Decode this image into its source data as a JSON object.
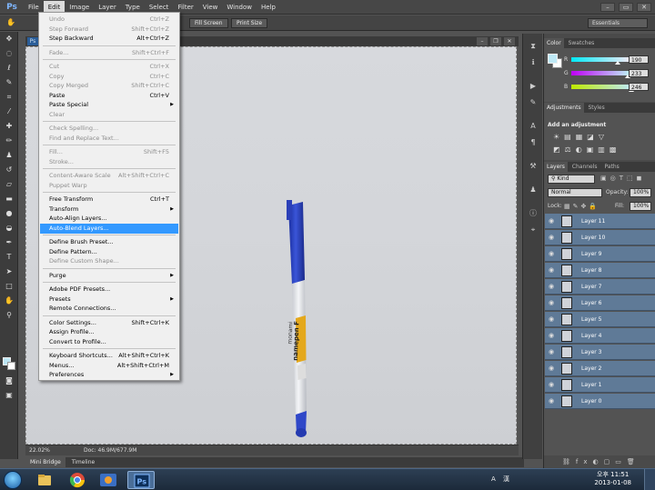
{
  "menubar": {
    "app_logo": "Ps",
    "items": [
      "File",
      "Edit",
      "Image",
      "Layer",
      "Type",
      "Select",
      "Filter",
      "View",
      "Window",
      "Help"
    ]
  },
  "options_bar": {
    "fill_screen": "Fill Screen",
    "print_size": "Print Size",
    "workspace": "Essentials"
  },
  "edit_menu": {
    "items": [
      {
        "label": "Undo",
        "shortcut": "Ctrl+Z",
        "disabled": true
      },
      {
        "label": "Step Forward",
        "shortcut": "Shift+Ctrl+Z",
        "disabled": true
      },
      {
        "label": "Step Backward",
        "shortcut": "Alt+Ctrl+Z",
        "disabled": false
      },
      {
        "label": "Fade...",
        "shortcut": "Shift+Ctrl+F",
        "disabled": true
      },
      {
        "label": "Cut",
        "shortcut": "Ctrl+X",
        "disabled": true
      },
      {
        "label": "Copy",
        "shortcut": "Ctrl+C",
        "disabled": true
      },
      {
        "label": "Copy Merged",
        "shortcut": "Shift+Ctrl+C",
        "disabled": true
      },
      {
        "label": "Paste",
        "shortcut": "Ctrl+V",
        "disabled": false
      },
      {
        "label": "Paste Special",
        "shortcut": "",
        "disabled": false,
        "submenu": true
      },
      {
        "label": "Clear",
        "shortcut": "",
        "disabled": true
      },
      {
        "label": "Check Spelling...",
        "shortcut": "",
        "disabled": true
      },
      {
        "label": "Find and Replace Text...",
        "shortcut": "",
        "disabled": true
      },
      {
        "label": "Fill...",
        "shortcut": "Shift+F5",
        "disabled": true
      },
      {
        "label": "Stroke...",
        "shortcut": "",
        "disabled": true
      },
      {
        "label": "Content-Aware Scale",
        "shortcut": "Alt+Shift+Ctrl+C",
        "disabled": true
      },
      {
        "label": "Puppet Warp",
        "shortcut": "",
        "disabled": true
      },
      {
        "label": "Free Transform",
        "shortcut": "Ctrl+T",
        "disabled": false
      },
      {
        "label": "Transform",
        "shortcut": "",
        "disabled": false,
        "submenu": true
      },
      {
        "label": "Auto-Align Layers...",
        "shortcut": "",
        "disabled": false
      },
      {
        "label": "Auto-Blend Layers...",
        "shortcut": "",
        "disabled": false,
        "highlighted": true
      },
      {
        "label": "Define Brush Preset...",
        "shortcut": "",
        "disabled": false
      },
      {
        "label": "Define Pattern...",
        "shortcut": "",
        "disabled": false
      },
      {
        "label": "Define Custom Shape...",
        "shortcut": "",
        "disabled": true
      },
      {
        "label": "Purge",
        "shortcut": "",
        "disabled": false,
        "submenu": true
      },
      {
        "label": "Adobe PDF Presets...",
        "shortcut": "",
        "disabled": false
      },
      {
        "label": "Presets",
        "shortcut": "",
        "disabled": false,
        "submenu": true
      },
      {
        "label": "Remote Connections...",
        "shortcut": "",
        "disabled": false
      },
      {
        "label": "Color Settings...",
        "shortcut": "Shift+Ctrl+K",
        "disabled": false
      },
      {
        "label": "Assign Profile...",
        "shortcut": "",
        "disabled": false
      },
      {
        "label": "Convert to Profile...",
        "shortcut": "",
        "disabled": false
      },
      {
        "label": "Keyboard Shortcuts...",
        "shortcut": "Alt+Shift+Ctrl+K",
        "disabled": false
      },
      {
        "label": "Menus...",
        "shortcut": "Alt+Shift+Ctrl+M",
        "disabled": false
      },
      {
        "label": "Preferences",
        "shortcut": "",
        "disabled": false,
        "submenu": true
      }
    ]
  },
  "document": {
    "tab_logo": "Ps",
    "marker_brand": "monami",
    "marker_label": "namepen F"
  },
  "status": {
    "zoom": "22.02%",
    "doc_size": "Doc: 46.9M/677.9M"
  },
  "bottom_tabs": [
    "Mini Bridge",
    "Timeline"
  ],
  "color_panel": {
    "tabs": [
      "Color",
      "Swatches"
    ],
    "channels": [
      {
        "label": "R",
        "value": "190",
        "fraction": 0.745
      },
      {
        "label": "G",
        "value": "233",
        "fraction": 0.914
      },
      {
        "label": "B",
        "value": "246",
        "fraction": 0.965
      }
    ],
    "foreground": "#bee9f6"
  },
  "adjustments_panel": {
    "tabs": [
      "Adjustments",
      "Styles"
    ],
    "header": "Add an adjustment"
  },
  "layers_panel": {
    "tabs": [
      "Layers",
      "Channels",
      "Paths"
    ],
    "kind_label": "Kind",
    "blend_mode": "Normal",
    "opacity_label": "Opacity:",
    "opacity_value": "100%",
    "lock_label": "Lock:",
    "fill_label": "Fill:",
    "fill_value": "100%",
    "layers": [
      "Layer 11",
      "Layer 10",
      "Layer 9",
      "Layer 8",
      "Layer 7",
      "Layer 6",
      "Layer 5",
      "Layer 4",
      "Layer 3",
      "Layer 2",
      "Layer 1",
      "Layer 0"
    ]
  },
  "taskbar": {
    "time": "오후 11:51",
    "date": "2013-01-08",
    "tray_text": "A 漢"
  },
  "colors": {
    "menu_highlight": "#3399ff",
    "layer_selected": "#5f7a97",
    "marker_blue": "#2f47c8"
  }
}
